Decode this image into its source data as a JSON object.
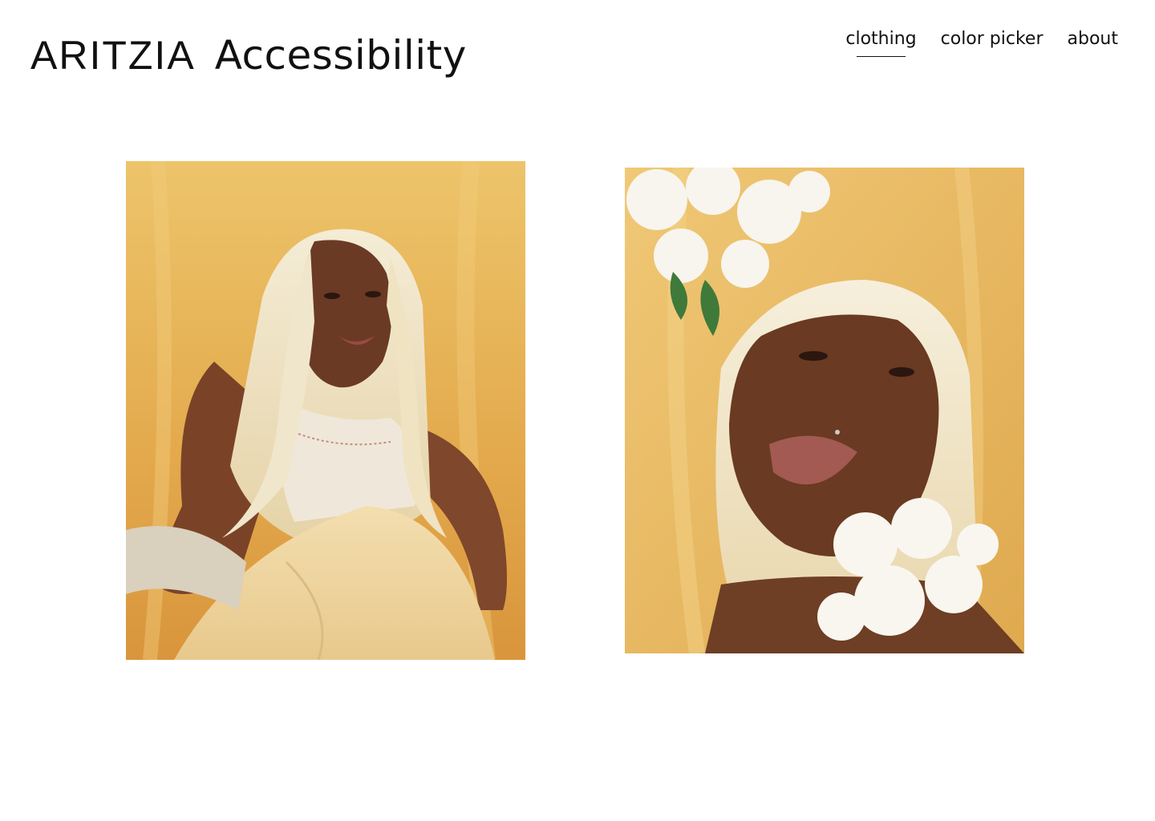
{
  "header": {
    "logo_text": "ARITZIA",
    "site_title": "Accessibility"
  },
  "nav": {
    "items": [
      {
        "label": "clothing",
        "active": true
      },
      {
        "label": "color picker",
        "active": false
      },
      {
        "label": "about",
        "active": false
      }
    ]
  },
  "gallery": {
    "left_caption": "",
    "right_caption": "",
    "photos": [
      {
        "subject": "portrait-seated-model",
        "background": "#e9b85a"
      },
      {
        "subject": "portrait-closeup-with-flowers",
        "background": "#e8bc62"
      }
    ]
  },
  "colors": {
    "text": "#111111",
    "background": "#ffffff",
    "backdrop_yellow": "#e9b85a",
    "hair": "#efe4c8",
    "skin": "#6b3d26"
  }
}
